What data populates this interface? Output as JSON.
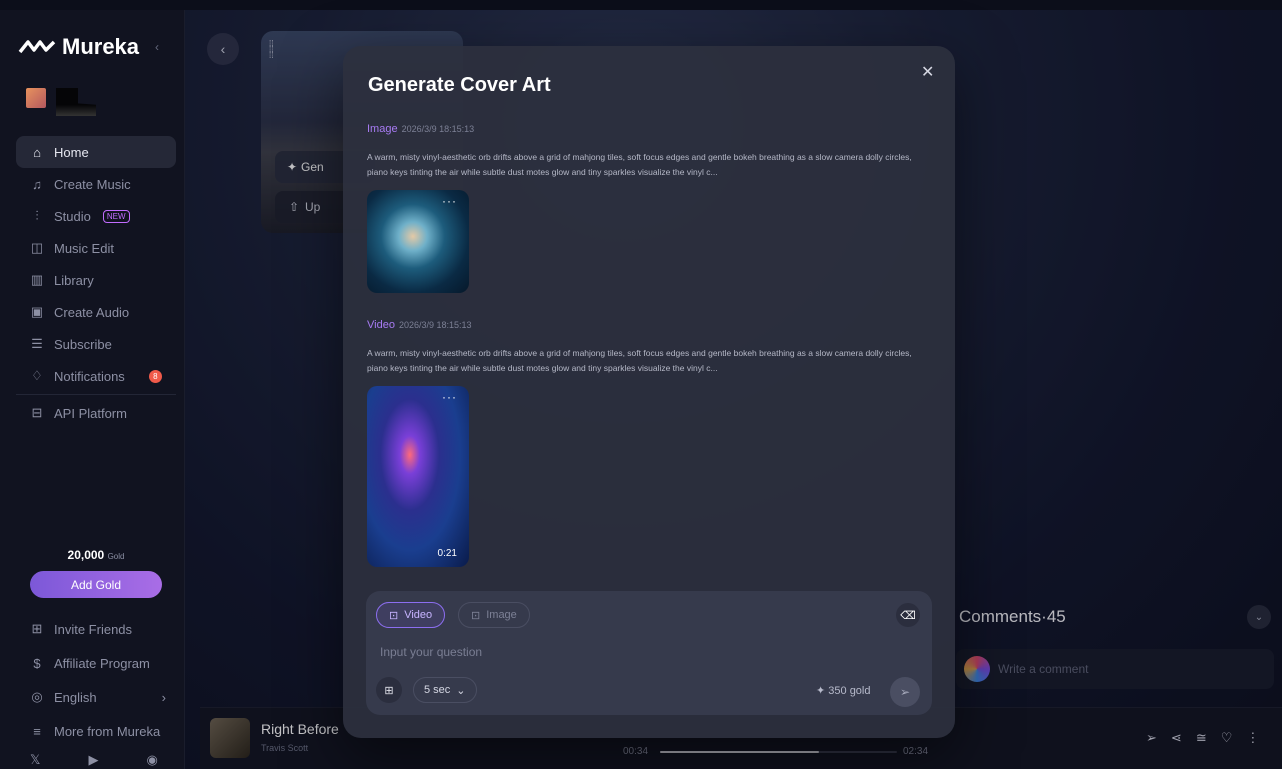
{
  "app": {
    "name": "Mureka"
  },
  "sidebar": {
    "items": [
      {
        "label": "Home",
        "icon": "home-icon"
      },
      {
        "label": "Create Music",
        "icon": "music-note-icon"
      },
      {
        "label": "Studio",
        "icon": "sliders-icon",
        "badge": "NEW"
      },
      {
        "label": "Music Edit",
        "icon": "music-edit-icon"
      },
      {
        "label": "Library",
        "icon": "library-icon"
      },
      {
        "label": "Create Audio",
        "icon": "audio-icon"
      },
      {
        "label": "Subscribe",
        "icon": "subscribe-icon"
      },
      {
        "label": "Notifications",
        "icon": "bell-icon",
        "count": "8"
      },
      {
        "label": "API Platform",
        "icon": "api-icon"
      }
    ],
    "gold": {
      "amount": "20,000",
      "unit": "Gold",
      "button": "Add Gold"
    },
    "bottom_items": [
      {
        "label": "Invite Friends",
        "icon": "gift-icon"
      },
      {
        "label": "Affiliate Program",
        "icon": "dollar-icon"
      },
      {
        "label": "English",
        "icon": "globe-icon"
      },
      {
        "label": "More from Mureka",
        "icon": "menu-icon"
      }
    ]
  },
  "card": {
    "button1": "Gen",
    "button2": "Up"
  },
  "modal": {
    "title": "Generate Cover Art",
    "image_section": {
      "label": "Image",
      "date": "2026/3/9 18:15:13",
      "prompt": "A warm, misty vinyl-aesthetic orb drifts above a grid of mahjong tiles, soft focus edges and gentle bokeh breathing as a slow camera dolly circles, piano keys tinting the air while subtle dust motes glow and tiny sparkles visualize the vinyl c..."
    },
    "video_section": {
      "label": "Video",
      "date": "2026/3/9 18:15:13",
      "prompt": "A warm, misty vinyl-aesthetic orb drifts above a grid of mahjong tiles, soft focus edges and gentle bokeh breathing as a slow camera dolly circles, piano keys tinting the air while subtle dust motes glow and tiny sparkles visualize the vinyl c...",
      "duration": "0:21"
    },
    "input": {
      "tab_video": "Video",
      "tab_image": "Image",
      "placeholder": "Input your question",
      "duration_select": "5 sec",
      "cost": "350 gold"
    }
  },
  "comments": {
    "title": "Comments·45",
    "placeholder": "Write a comment"
  },
  "player": {
    "title": "Right Before",
    "artist": "Travis Scott",
    "current": "00:34",
    "total": "02:34",
    "progress": 0.67
  }
}
